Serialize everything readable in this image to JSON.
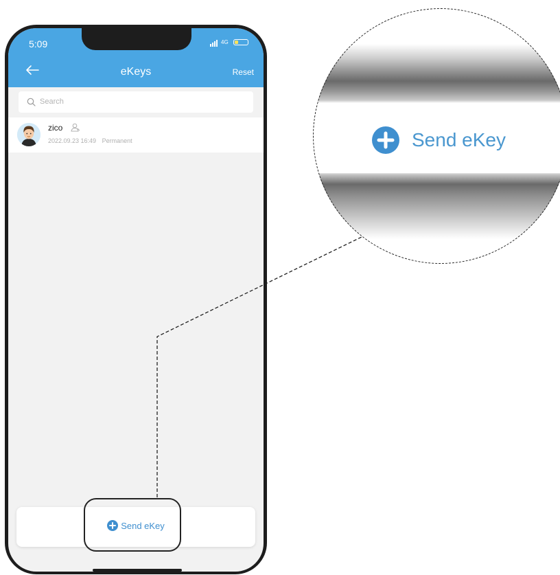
{
  "status": {
    "time": "5:09",
    "network": "4G"
  },
  "nav": {
    "title": "eKeys",
    "reset_label": "Reset"
  },
  "search": {
    "placeholder": "Search"
  },
  "ekeys": [
    {
      "name": "zico",
      "date": "2022.09.23 16:49",
      "validity": "Permanent"
    }
  ],
  "footer": {
    "send_label": "Send eKey"
  },
  "callout": {
    "send_label": "Send eKey"
  },
  "colors": {
    "header": "#4aa6e3",
    "accent": "#3f8fcf",
    "background": "#f2f2f2"
  },
  "icons": [
    "back-arrow-icon",
    "search-icon",
    "user-icon",
    "plus-circle-icon"
  ]
}
